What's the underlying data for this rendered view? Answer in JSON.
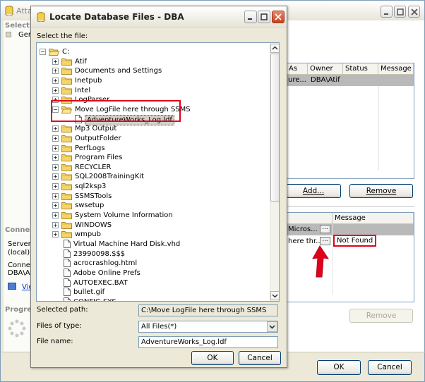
{
  "background_window": {
    "title": "Atta",
    "select_a_page": "Select a",
    "general_page": "Gen",
    "grid1_headers": [
      "As",
      "Owner",
      "Status",
      "Message"
    ],
    "grid1_row": [
      "ure...",
      "DBA\\Atif",
      "",
      ""
    ],
    "add_button": "Add...",
    "remove_button": "Remove",
    "grid2_header_message": "Message",
    "grid2_rows": [
      {
        "path": "Micros...",
        "message": ""
      },
      {
        "path": "here thr...",
        "message": "Not Found"
      }
    ],
    "remove_button_2": "Remove",
    "connection_label": "Conne",
    "server_label": "Server:",
    "server_value": "(local)",
    "connection2_label": "Conne",
    "connection2_value": "DBA\\At",
    "view_link": "Vie",
    "progress_label": "Progre",
    "ok_button": "OK",
    "cancel_button": "Cancel"
  },
  "dialog": {
    "title": "Locate Database Files - DBA",
    "select_file_label": "Select the file:",
    "tree": [
      {
        "label": "C:",
        "level": 0,
        "type": "drive",
        "expander": "-"
      },
      {
        "label": "Atif",
        "level": 1,
        "type": "folder",
        "expander": "+"
      },
      {
        "label": "Documents and Settings",
        "level": 1,
        "type": "folder",
        "expander": "+"
      },
      {
        "label": "Inetpub",
        "level": 1,
        "type": "folder",
        "expander": "+"
      },
      {
        "label": "Intel",
        "level": 1,
        "type": "folder",
        "expander": "+"
      },
      {
        "label": "LogParser",
        "level": 1,
        "type": "folder",
        "expander": "+"
      },
      {
        "label": "Move LogFile here through SSMS",
        "level": 1,
        "type": "folder",
        "expander": "-"
      },
      {
        "label": "AdventureWorks_Log.ldf",
        "level": 2,
        "type": "file",
        "expander": "",
        "selected": true
      },
      {
        "label": "Mp3 Output",
        "level": 1,
        "type": "folder",
        "expander": "+"
      },
      {
        "label": "OutputFolder",
        "level": 1,
        "type": "folder",
        "expander": "+"
      },
      {
        "label": "PerfLogs",
        "level": 1,
        "type": "folder",
        "expander": "+"
      },
      {
        "label": "Program Files",
        "level": 1,
        "type": "folder",
        "expander": "+"
      },
      {
        "label": "RECYCLER",
        "level": 1,
        "type": "folder",
        "expander": "+"
      },
      {
        "label": "SQL2008TrainingKit",
        "level": 1,
        "type": "folder",
        "expander": "+"
      },
      {
        "label": "sql2ksp3",
        "level": 1,
        "type": "folder",
        "expander": "+"
      },
      {
        "label": "SSMSTools",
        "level": 1,
        "type": "folder",
        "expander": "+"
      },
      {
        "label": "swsetup",
        "level": 1,
        "type": "folder",
        "expander": "+"
      },
      {
        "label": "System Volume Information",
        "level": 1,
        "type": "folder",
        "expander": "+"
      },
      {
        "label": "WINDOWS",
        "level": 1,
        "type": "folder",
        "expander": "+"
      },
      {
        "label": "wmpub",
        "level": 1,
        "type": "folder",
        "expander": "+"
      },
      {
        "label": "Virtual Machine Hard Disk.vhd",
        "level": 1,
        "type": "file",
        "expander": ""
      },
      {
        "label": "23990098.$$$",
        "level": 1,
        "type": "file",
        "expander": ""
      },
      {
        "label": "acrocrashlog.html",
        "level": 1,
        "type": "file",
        "expander": ""
      },
      {
        "label": "Adobe Online Prefs",
        "level": 1,
        "type": "file",
        "expander": ""
      },
      {
        "label": "AUTOEXEC.BAT",
        "level": 1,
        "type": "file",
        "expander": ""
      },
      {
        "label": "bullet.gif",
        "level": 1,
        "type": "file",
        "expander": ""
      },
      {
        "label": "CONFIG.SYS",
        "level": 1,
        "type": "file",
        "expander": ""
      }
    ],
    "selected_path_label": "Selected path:",
    "selected_path_value": "C:\\Move LogFile here through SSMS",
    "files_of_type_label": "Files of type:",
    "files_of_type_value": "All Files(*)",
    "file_name_label": "File name:",
    "file_name_value": "AdventureWorks_Log.ldf",
    "ok_button": "OK",
    "cancel_button": "Cancel"
  },
  "colors": {
    "highlight": "#e3001b",
    "arrow": "#e3001b",
    "selection": "#3169c6"
  }
}
